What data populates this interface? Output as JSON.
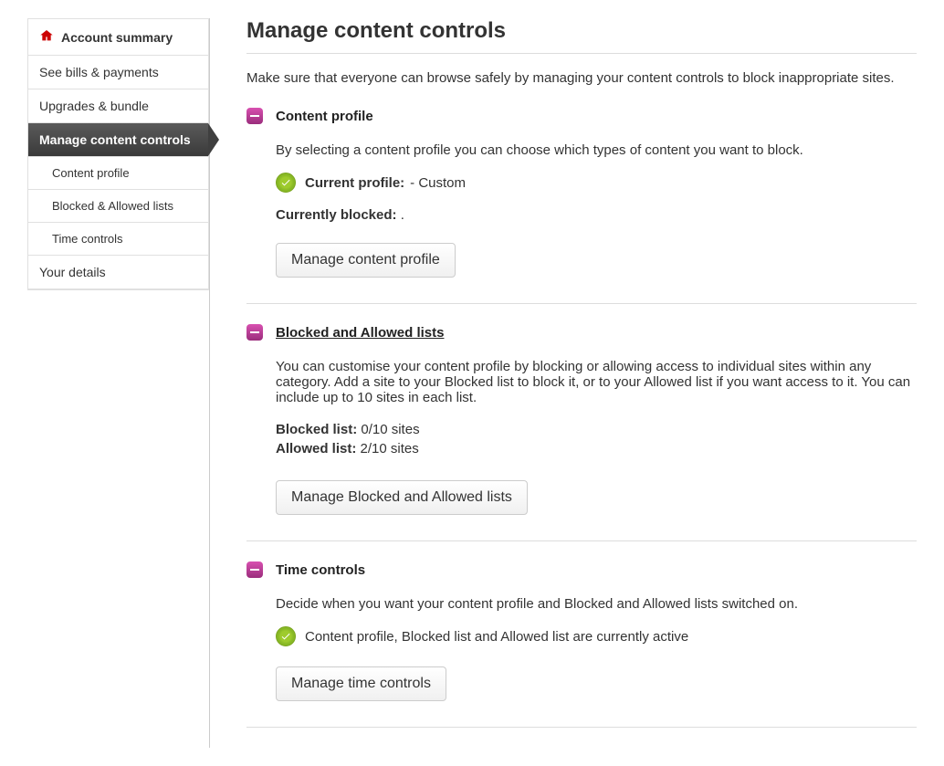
{
  "sidebar": {
    "summary": "Account summary",
    "items": [
      "See bills & payments",
      "Upgrades & bundle",
      "Manage content controls"
    ],
    "subitems": [
      "Content profile",
      "Blocked & Allowed lists",
      "Time controls"
    ],
    "last": "Your details"
  },
  "page": {
    "title": "Manage content controls",
    "intro": "Make sure that everyone can browse safely by managing your content controls to block inappropriate sites."
  },
  "content_profile": {
    "title": "Content profile",
    "desc": "By selecting a content profile you can choose which types of content you want to block.",
    "current_label": "Current profile:",
    "current_value": "- Custom",
    "blocked_label": "Currently blocked:",
    "blocked_value": ".",
    "button": "Manage content profile"
  },
  "lists": {
    "title": "Blocked and Allowed lists",
    "desc": "You can customise your content profile by blocking or allowing access to individual sites within any category. Add a site to your Blocked list to block it, or to your Allowed list if you want access to it. You can include up to 10 sites in each list.",
    "blocked_label": "Blocked list:",
    "blocked_value": "0/10 sites",
    "allowed_label": "Allowed list:",
    "allowed_value": "2/10 sites",
    "button": "Manage Blocked and Allowed lists"
  },
  "time": {
    "title": "Time controls",
    "desc": "Decide when you want your content profile and Blocked and Allowed lists switched on.",
    "status": "Content profile, Blocked list and Allowed list are currently active",
    "button": "Manage time controls"
  }
}
